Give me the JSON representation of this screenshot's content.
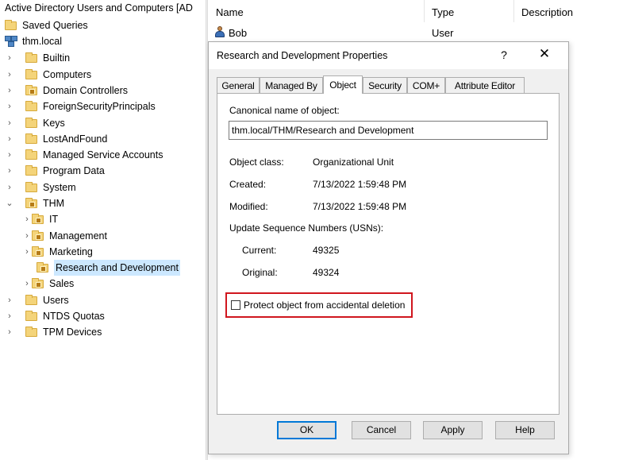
{
  "tree": {
    "root_label": "Active Directory Users and Computers [AD",
    "items": [
      {
        "label": "Saved Queries"
      },
      {
        "label": "thm.local"
      },
      {
        "label": "Builtin"
      },
      {
        "label": "Computers"
      },
      {
        "label": "Domain Controllers"
      },
      {
        "label": "ForeignSecurityPrincipals"
      },
      {
        "label": "Keys"
      },
      {
        "label": "LostAndFound"
      },
      {
        "label": "Managed Service Accounts"
      },
      {
        "label": "Program Data"
      },
      {
        "label": "System"
      },
      {
        "label": "THM"
      },
      {
        "label": "IT"
      },
      {
        "label": "Management"
      },
      {
        "label": "Marketing"
      },
      {
        "label": "Research and Development"
      },
      {
        "label": "Sales"
      },
      {
        "label": "Users"
      },
      {
        "label": "NTDS Quotas"
      },
      {
        "label": "TPM Devices"
      }
    ],
    "selected": "Research and Development"
  },
  "list": {
    "columns": [
      "Name",
      "Type",
      "Description"
    ],
    "rows": [
      {
        "name": "Bob",
        "type": "User"
      }
    ]
  },
  "dialog": {
    "title": "Research and Development Properties",
    "help_glyph": "?",
    "close_glyph": "✕",
    "tabs": [
      "General",
      "Managed By",
      "Object",
      "Security",
      "COM+",
      "Attribute Editor"
    ],
    "active_tab": "Object",
    "canonical_label": "Canonical name of object:",
    "canonical_value": "thm.local/THM/Research and Development",
    "object_class_label": "Object class:",
    "object_class_value": "Organizational Unit",
    "created_label": "Created:",
    "created_value": "7/13/2022 1:59:48 PM",
    "modified_label": "Modified:",
    "modified_value": "7/13/2022 1:59:48 PM",
    "usn_label": "Update Sequence Numbers (USNs):",
    "current_label": "Current:",
    "current_value": "49325",
    "original_label": "Original:",
    "original_value": "49324",
    "protect_label": "Protect object from accidental deletion",
    "protect_checked": false,
    "highlight_color": "#d0161e",
    "buttons": {
      "ok": "OK",
      "cancel": "Cancel",
      "apply": "Apply",
      "help": "Help"
    }
  }
}
